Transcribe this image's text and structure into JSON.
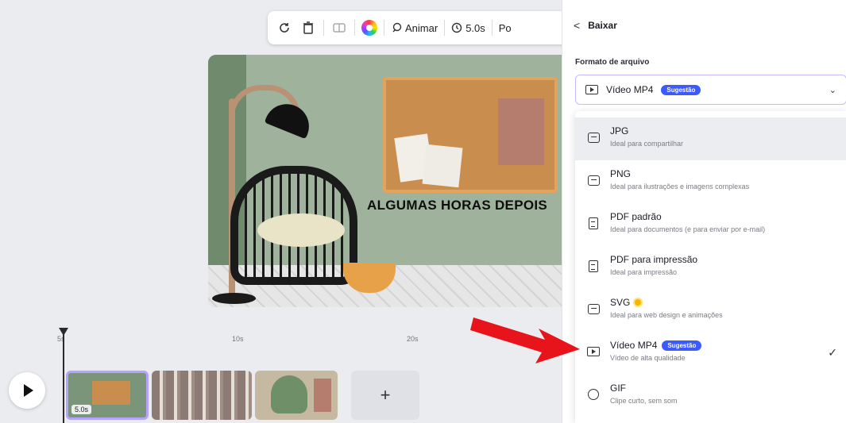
{
  "toolbar": {
    "animate_label": "Animar",
    "duration_label": "5.0s",
    "more_label": "Po"
  },
  "scene": {
    "text": "ALGUMAS HORAS DEPOIS"
  },
  "timeline": {
    "ticks": [
      "5s",
      "10s",
      "20s"
    ],
    "clip_duration": "5.0s",
    "add_label": "+"
  },
  "panel": {
    "back_label": "<",
    "title": "Baixar",
    "section_label": "Formato de arquivo",
    "selected_format": "Vídeo MP4",
    "selected_badge": "Sugestão",
    "options": [
      {
        "name": "JPG",
        "desc": "Ideal para compartilhar"
      },
      {
        "name": "PNG",
        "desc": "Ideal para ilustrações e imagens complexas"
      },
      {
        "name": "PDF padrão",
        "desc": "Ideal para documentos (e para enviar por e-mail)"
      },
      {
        "name": "PDF para impressão",
        "desc": "Ideal para impressão"
      },
      {
        "name": "SVG",
        "desc": "Ideal para web design e animações"
      },
      {
        "name": "Vídeo MP4",
        "badge": "Sugestão",
        "desc": "Vídeo de alta qualidade"
      },
      {
        "name": "GIF",
        "desc": "Clipe curto, sem som"
      }
    ]
  },
  "colors": {
    "accent": "#3d5afe",
    "arrow": "#e8141c",
    "selection": "#b6a2ff"
  }
}
